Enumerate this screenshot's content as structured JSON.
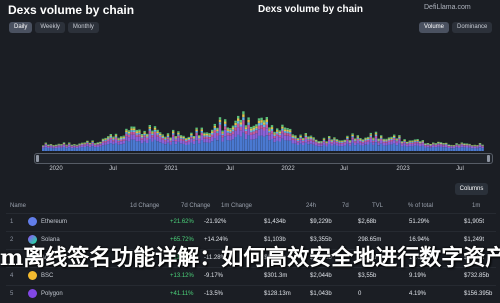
{
  "header": {
    "title_left": "Dexs volume by chain",
    "title_right": "Dexs volume by chain",
    "source": "DefiLlama.com",
    "left_tabs": [
      "Daily",
      "Weekly",
      "Monthly"
    ],
    "right_tabs": [
      "Volume",
      "Dominance"
    ],
    "active_left": "Daily",
    "active_right": "Volume"
  },
  "chart_data": {
    "type": "area",
    "title": "Dexs volume by chain",
    "x_ticks": [
      "2020",
      "Jul",
      "2021",
      "Jul",
      "2022",
      "Jul",
      "2023",
      "Jul"
    ],
    "series_colors": [
      "#4a79d1",
      "#8a62d8",
      "#c05a9e",
      "#62b3e6",
      "#e0c04b",
      "#5bc07a"
    ]
  },
  "legend": {
    "label": "Columns"
  },
  "table": {
    "columns": [
      "Name",
      "1d Change",
      "7d Change",
      "1m Change",
      "24h",
      "7d",
      "TVL",
      "% of total",
      "1m"
    ],
    "rows": [
      {
        "num": "1",
        "name": "Ethereum",
        "c1": "+21.62%",
        "c2": "-21.92%",
        "c3": "$1,434b",
        "c4": "$9,229b",
        "c5": "$2,68b",
        "c6": "51.29%",
        "c7": "$1,905t"
      },
      {
        "num": "2",
        "name": "Solana",
        "c1": "+65.72%",
        "c2": "+14.24%",
        "c3": "$1,103b",
        "c4": "$3,355b",
        "c5": "298.65m",
        "c6": "16.94%",
        "c7": "$1,249t"
      },
      {
        "num": "3",
        "name": "Arbitrum",
        "c1": "+11.82%",
        "c2": "-11.28%",
        "c3": "$1,302b",
        "c4": "$2,938b",
        "c5": "$2,38b",
        "c6": "14.02%",
        "c7": "$1,148t"
      },
      {
        "num": "4",
        "name": "BSC",
        "c1": "+13.12%",
        "c2": "-9.17%",
        "c3": "$301.3m",
        "c4": "$2,044b",
        "c5": "$3,55b",
        "c6": "9.19%",
        "c7": "$732.85b"
      },
      {
        "num": "5",
        "name": "Polygon",
        "c1": "+41.11%",
        "c2": "-13.5%",
        "c3": "$128.13m",
        "c4": "$1,043b",
        "c5": "0",
        "c6": "4.19%",
        "c7": "$156.395b"
      }
    ]
  },
  "overlay": {
    "text": "m离线签名功能详解：如何高效安全地进行数字资产管理"
  }
}
